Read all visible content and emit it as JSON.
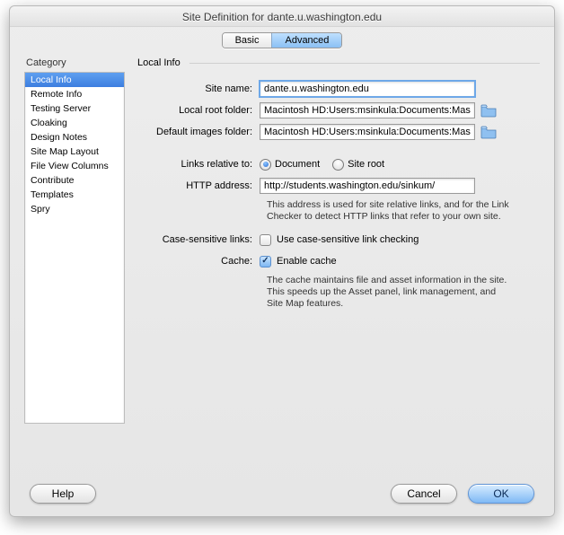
{
  "window": {
    "title": "Site Definition for dante.u.washington.edu"
  },
  "tabs": {
    "basic": "Basic",
    "advanced": "Advanced"
  },
  "sidebar": {
    "heading": "Category",
    "items": [
      "Local Info",
      "Remote Info",
      "Testing Server",
      "Cloaking",
      "Design Notes",
      "Site Map Layout",
      "File View Columns",
      "Contribute",
      "Templates",
      "Spry"
    ]
  },
  "panel": {
    "heading": "Local Info",
    "labels": {
      "site_name": "Site name:",
      "local_root": "Local root folder:",
      "default_images": "Default images folder:",
      "links_relative": "Links relative to:",
      "http_address": "HTTP address:",
      "case_sensitive": "Case-sensitive links:",
      "cache": "Cache:"
    },
    "values": {
      "site_name": "dante.u.washington.edu",
      "local_root": "Macintosh HD:Users:msinkula:Documents:Mas",
      "default_images": "Macintosh HD:Users:msinkula:Documents:Mas",
      "http_address": "http://students.washington.edu/sinkum/"
    },
    "radios": {
      "document": "Document",
      "site_root": "Site root"
    },
    "checks": {
      "case_label": "Use case-sensitive link checking",
      "cache_label": "Enable cache"
    },
    "help": {
      "http": "This address is used for site relative links, and for the Link Checker to detect HTTP links that refer to your own site.",
      "cache": "The cache maintains file and asset information in the site.  This speeds up the Asset panel, link management, and Site Map features."
    }
  },
  "footer": {
    "help": "Help",
    "cancel": "Cancel",
    "ok": "OK"
  }
}
